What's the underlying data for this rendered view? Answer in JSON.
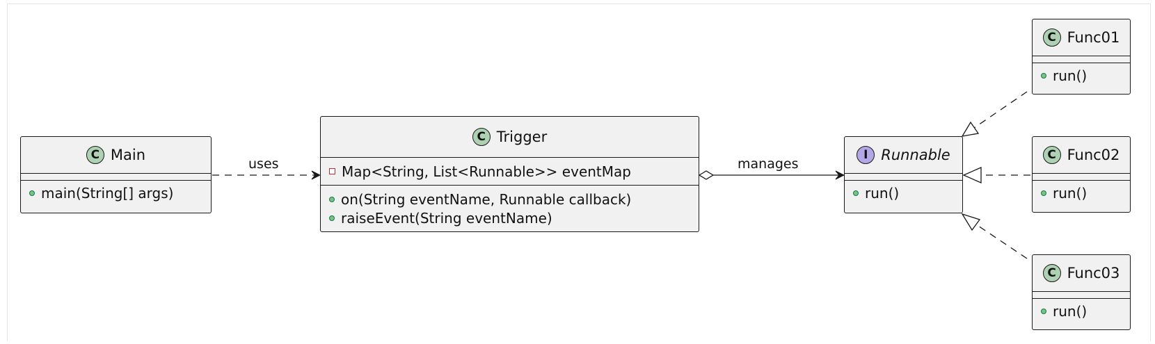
{
  "classes": {
    "main": {
      "kind": "class",
      "stereotype": "C",
      "name": "Main",
      "fields": [],
      "methods": [
        {
          "visibility": "public",
          "text": "main(String[] args)"
        }
      ]
    },
    "trigger": {
      "kind": "class",
      "stereotype": "C",
      "name": "Trigger",
      "fields": [
        {
          "visibility": "private",
          "text": "Map<String, List<Runnable>> eventMap"
        }
      ],
      "methods": [
        {
          "visibility": "public",
          "text": "on(String eventName, Runnable callback)"
        },
        {
          "visibility": "public",
          "text": "raiseEvent(String eventName)"
        }
      ]
    },
    "runnable": {
      "kind": "interface",
      "stereotype": "I",
      "name": "Runnable",
      "fields": [],
      "methods": [
        {
          "visibility": "public",
          "text": "run()"
        }
      ]
    },
    "func01": {
      "kind": "class",
      "stereotype": "C",
      "name": "Func01",
      "fields": [],
      "methods": [
        {
          "visibility": "public",
          "text": "run()"
        }
      ]
    },
    "func02": {
      "kind": "class",
      "stereotype": "C",
      "name": "Func02",
      "fields": [],
      "methods": [
        {
          "visibility": "public",
          "text": "run()"
        }
      ]
    },
    "func03": {
      "kind": "class",
      "stereotype": "C",
      "name": "Func03",
      "fields": [],
      "methods": [
        {
          "visibility": "public",
          "text": "run()"
        }
      ]
    }
  },
  "relations": [
    {
      "from": "Main",
      "to": "Trigger",
      "type": "dependency",
      "label": "uses"
    },
    {
      "from": "Trigger",
      "to": "Runnable",
      "type": "aggregation",
      "label": "manages"
    },
    {
      "from": "Func01",
      "to": "Runnable",
      "type": "realization",
      "label": ""
    },
    {
      "from": "Func02",
      "to": "Runnable",
      "type": "realization",
      "label": ""
    },
    {
      "from": "Func03",
      "to": "Runnable",
      "type": "realization",
      "label": ""
    }
  ],
  "colors": {
    "class_fill": "#f1f1f1",
    "border": "#181818",
    "class_stereotype_fill": "#add1b2",
    "interface_stereotype_fill": "#b4a7e5",
    "public_marker": "#84be84",
    "private_marker": "#c82930"
  }
}
